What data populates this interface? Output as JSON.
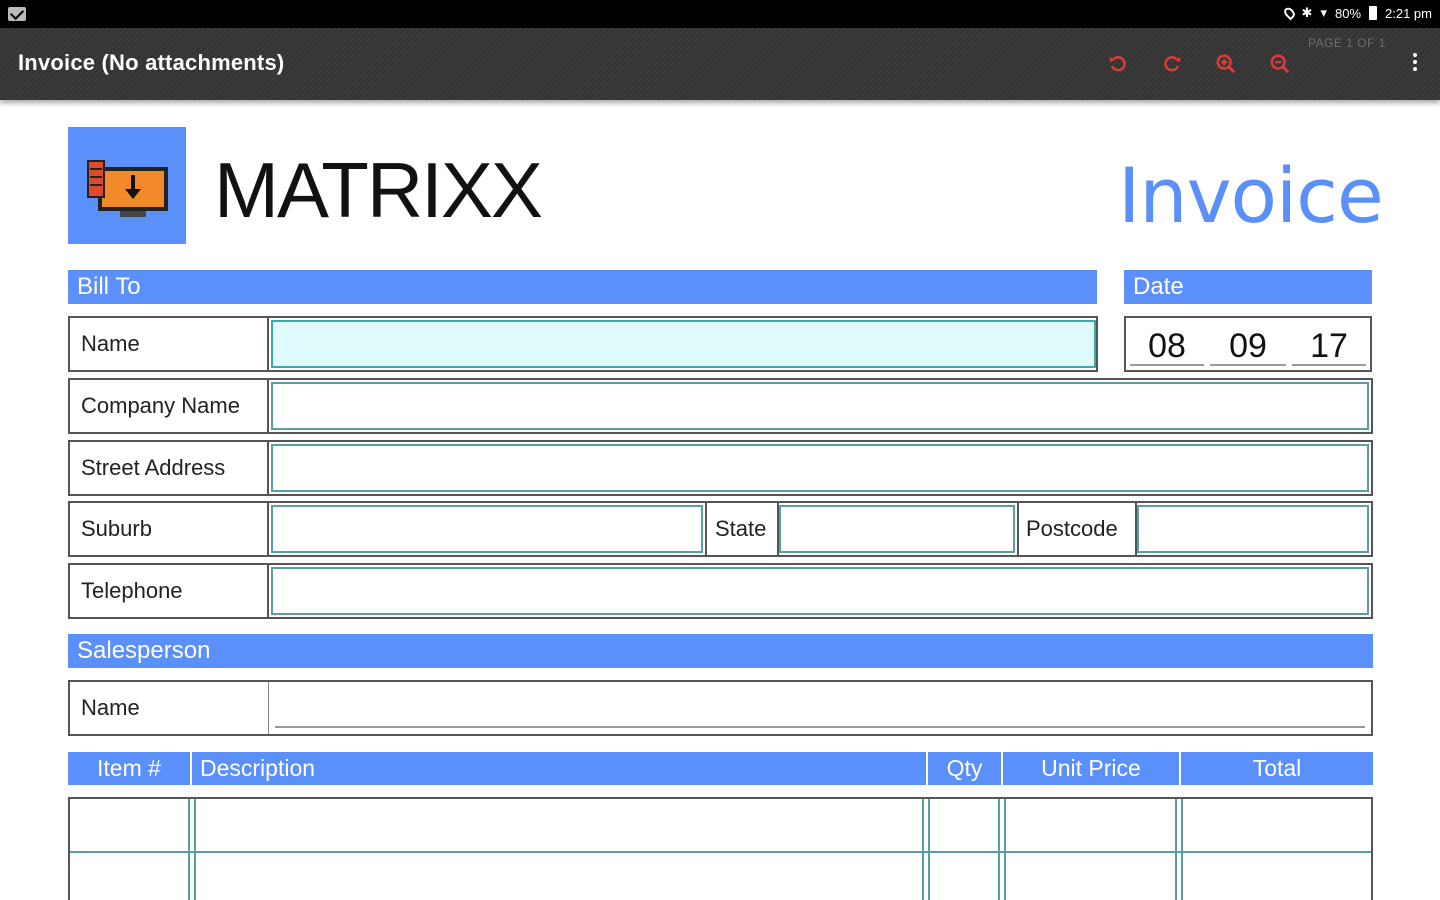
{
  "statusbar": {
    "mail_icon": "mail-icon",
    "battery_text": "80%",
    "time": "2:21 pm"
  },
  "appbar": {
    "title": "Invoice (No attachments)",
    "page_info": "PAGE 1 OF 1",
    "icons": [
      "rotate-left-icon",
      "rotate-right-icon",
      "zoom-in-icon",
      "zoom-out-icon",
      "overflow-menu-icon"
    ],
    "icon_color": "#e53935"
  },
  "document": {
    "brand": "MATRIXX",
    "title": "Invoice",
    "accent_color": "#5b8ff9",
    "bill_to": {
      "header": "Bill To",
      "name_label": "Name",
      "company_label": "Company Name",
      "street_label": "Street Address",
      "suburb_label": "Suburb",
      "state_label": "State",
      "postcode_label": "Postcode",
      "telephone_label": "Telephone"
    },
    "date": {
      "header": "Date",
      "day": "08",
      "month": "09",
      "year": "17"
    },
    "salesperson": {
      "header": "Salesperson",
      "name_label": "Name"
    },
    "items_table": {
      "columns": [
        "Item #",
        "Description",
        "Qty",
        "Unit Price",
        "Total"
      ]
    }
  }
}
